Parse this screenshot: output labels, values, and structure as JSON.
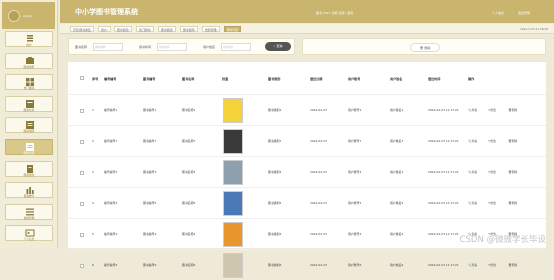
{
  "app": {
    "title": "中小学图书管理系统",
    "admin_name": "admin"
  },
  "header": {
    "info": "图书 2017 功能 实用 | 首页",
    "link_front": "个人信息",
    "link_logout": "退出登录"
  },
  "sidebar": [
    {
      "label": "用户",
      "icon": "user-icon",
      "active": false
    },
    {
      "label": "图书类型",
      "icon": "book-type-icon",
      "active": false
    },
    {
      "label": "热门图书",
      "icon": "hot-book-icon",
      "active": false
    },
    {
      "label": "图书信息",
      "icon": "book-info-icon",
      "active": false
    },
    {
      "label": "图书借阅",
      "icon": "borrow-icon",
      "active": false
    },
    {
      "label": "图书归还",
      "icon": "return-icon",
      "active": true
    },
    {
      "label": "图书预约",
      "icon": "reserve-icon",
      "active": false
    },
    {
      "label": "借阅统计",
      "icon": "stats-icon",
      "active": false
    },
    {
      "label": "系统管理",
      "icon": "system-icon",
      "active": false
    },
    {
      "label": "个人信息",
      "icon": "profile-icon",
      "active": false
    }
  ],
  "tabs": [
    "首页/图书类型",
    "用户/",
    "图书借阅/",
    "热门图书/",
    "图书借阅/",
    "图书借阅/",
    "借阅管理/",
    "图书归还"
  ],
  "date": "2024-4-23 21:38:38",
  "search": {
    "field1_label": "图书名称",
    "field1_placeholder": "图书名称",
    "field2_label": "借书时间",
    "field2_placeholder": "借书时间",
    "field3_label": "用户姓名",
    "field3_placeholder": "用户姓名",
    "button": "查询"
  },
  "toolbar": {
    "delete": "删除"
  },
  "table": {
    "headers": [
      "序号",
      "编号编号",
      "图书编号",
      "图书名称",
      "封面",
      "图书类别",
      "借还日期",
      "用户账号",
      "用户姓名",
      "借还时间",
      "操作"
    ],
    "rows": [
      {
        "no": "1",
        "code": "编号编号1",
        "book_no": "图书编号1",
        "book_name": "图书名称1",
        "cat": "图书类别1",
        "date": "2024-04-23",
        "acct": "用户账号1",
        "uname": "用户姓名1",
        "time": "2024-04-23 11:17:21",
        "cover": "#f5d23a"
      },
      {
        "no": "2",
        "code": "编号编号7",
        "book_no": "图书编号7",
        "book_name": "图书名称7",
        "cat": "图书类别7",
        "date": "2024-04-23",
        "acct": "用户账号7",
        "uname": "用户姓名7",
        "time": "2024-04-23 11:17:21",
        "cover": "#3a3a3a"
      },
      {
        "no": "3",
        "code": "编号编号3",
        "book_no": "图书编号3",
        "book_name": "图书名称3",
        "cat": "图书类别3",
        "date": "2024-04-23",
        "acct": "用户账号3",
        "uname": "用户姓名3",
        "time": "2024-04-23 11:17:21",
        "cover": "#8da0b0"
      },
      {
        "no": "4",
        "code": "编号编号5",
        "book_no": "图书编号5",
        "book_name": "图书名称5",
        "cat": "图书类别5",
        "date": "2024-04-23",
        "acct": "用户账号5",
        "uname": "用户姓名5",
        "time": "2024-04-23 11:17:21",
        "cover": "#4a79b8"
      },
      {
        "no": "5",
        "code": "编号编号4",
        "book_no": "图书编号4",
        "book_name": "图书名称4",
        "cat": "图书类别4",
        "date": "2024-04-23",
        "acct": "用户账号4",
        "uname": "用户姓名4",
        "time": "2024-04-23 11:17:21",
        "cover": "#e8962e"
      },
      {
        "no": "6",
        "code": "编号编号6",
        "book_no": "图书编号6",
        "book_name": "图书名称6",
        "cat": "图书类别6",
        "date": "2024-04-23",
        "acct": "用户账号6",
        "uname": "用户姓名6",
        "time": "2024-04-23 11:17:21",
        "cover": "#cfc6b0"
      }
    ],
    "ops": {
      "view": "查看",
      "edit": "修改",
      "delete": "删除"
    }
  },
  "watermark": "CSDN @微微学长毕设"
}
